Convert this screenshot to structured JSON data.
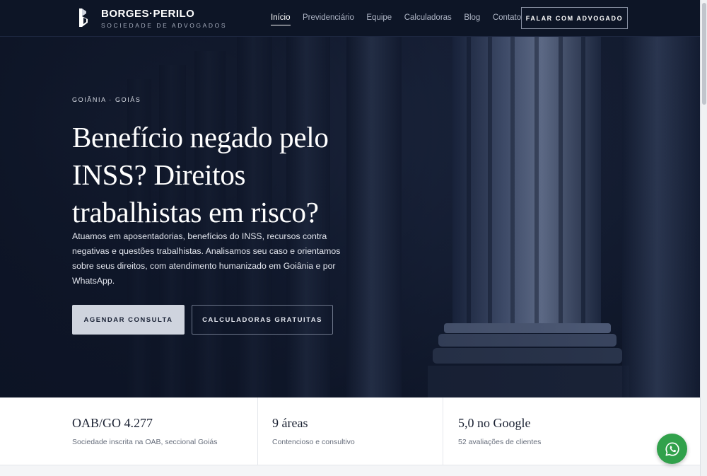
{
  "brand": {
    "name": "BORGES·PERILO",
    "subtitle": "SOCIEDADE DE ADVOGADOS"
  },
  "nav": {
    "items": [
      {
        "label": "Início",
        "active": true
      },
      {
        "label": "Previdenciário",
        "active": false
      },
      {
        "label": "Equipe",
        "active": false
      },
      {
        "label": "Calculadoras",
        "active": false
      },
      {
        "label": "Blog",
        "active": false
      },
      {
        "label": "Contato",
        "active": false
      }
    ],
    "cta_label": "FALAR COM ADVOGADO"
  },
  "hero": {
    "eyebrow": "GOIÂNIA · GOIÁS",
    "headline": "Benefício negado pelo INSS? Direitos trabalhistas em risco?",
    "lead": "Atuamos em aposentadorias, benefícios do INSS, recursos contra negativas e questões trabalhistas. Analisamos seu caso e orientamos sobre seus direitos, com atendimento humanizado em Goiânia e por WhatsApp.",
    "primary_button": "AGENDAR CONSULTA",
    "secondary_button": "CALCULADORAS GRATUITAS"
  },
  "stats": [
    {
      "value": "OAB/GO 4.277",
      "label": "Sociedade inscrita na OAB, seccional Goiás"
    },
    {
      "value": "9 áreas",
      "label": "Contencioso e consultivo"
    },
    {
      "value": "5,0 no Google",
      "label": "52 avaliações de clientes"
    }
  ],
  "colors": {
    "header_bg": "#0d1526",
    "hero_bg": "#1a243c",
    "primary_button_bg": "#cfd4de",
    "whatsapp_green": "#31a14b"
  },
  "icons": {
    "logo": "brand-monogram-icon",
    "whatsapp": "whatsapp-icon"
  }
}
